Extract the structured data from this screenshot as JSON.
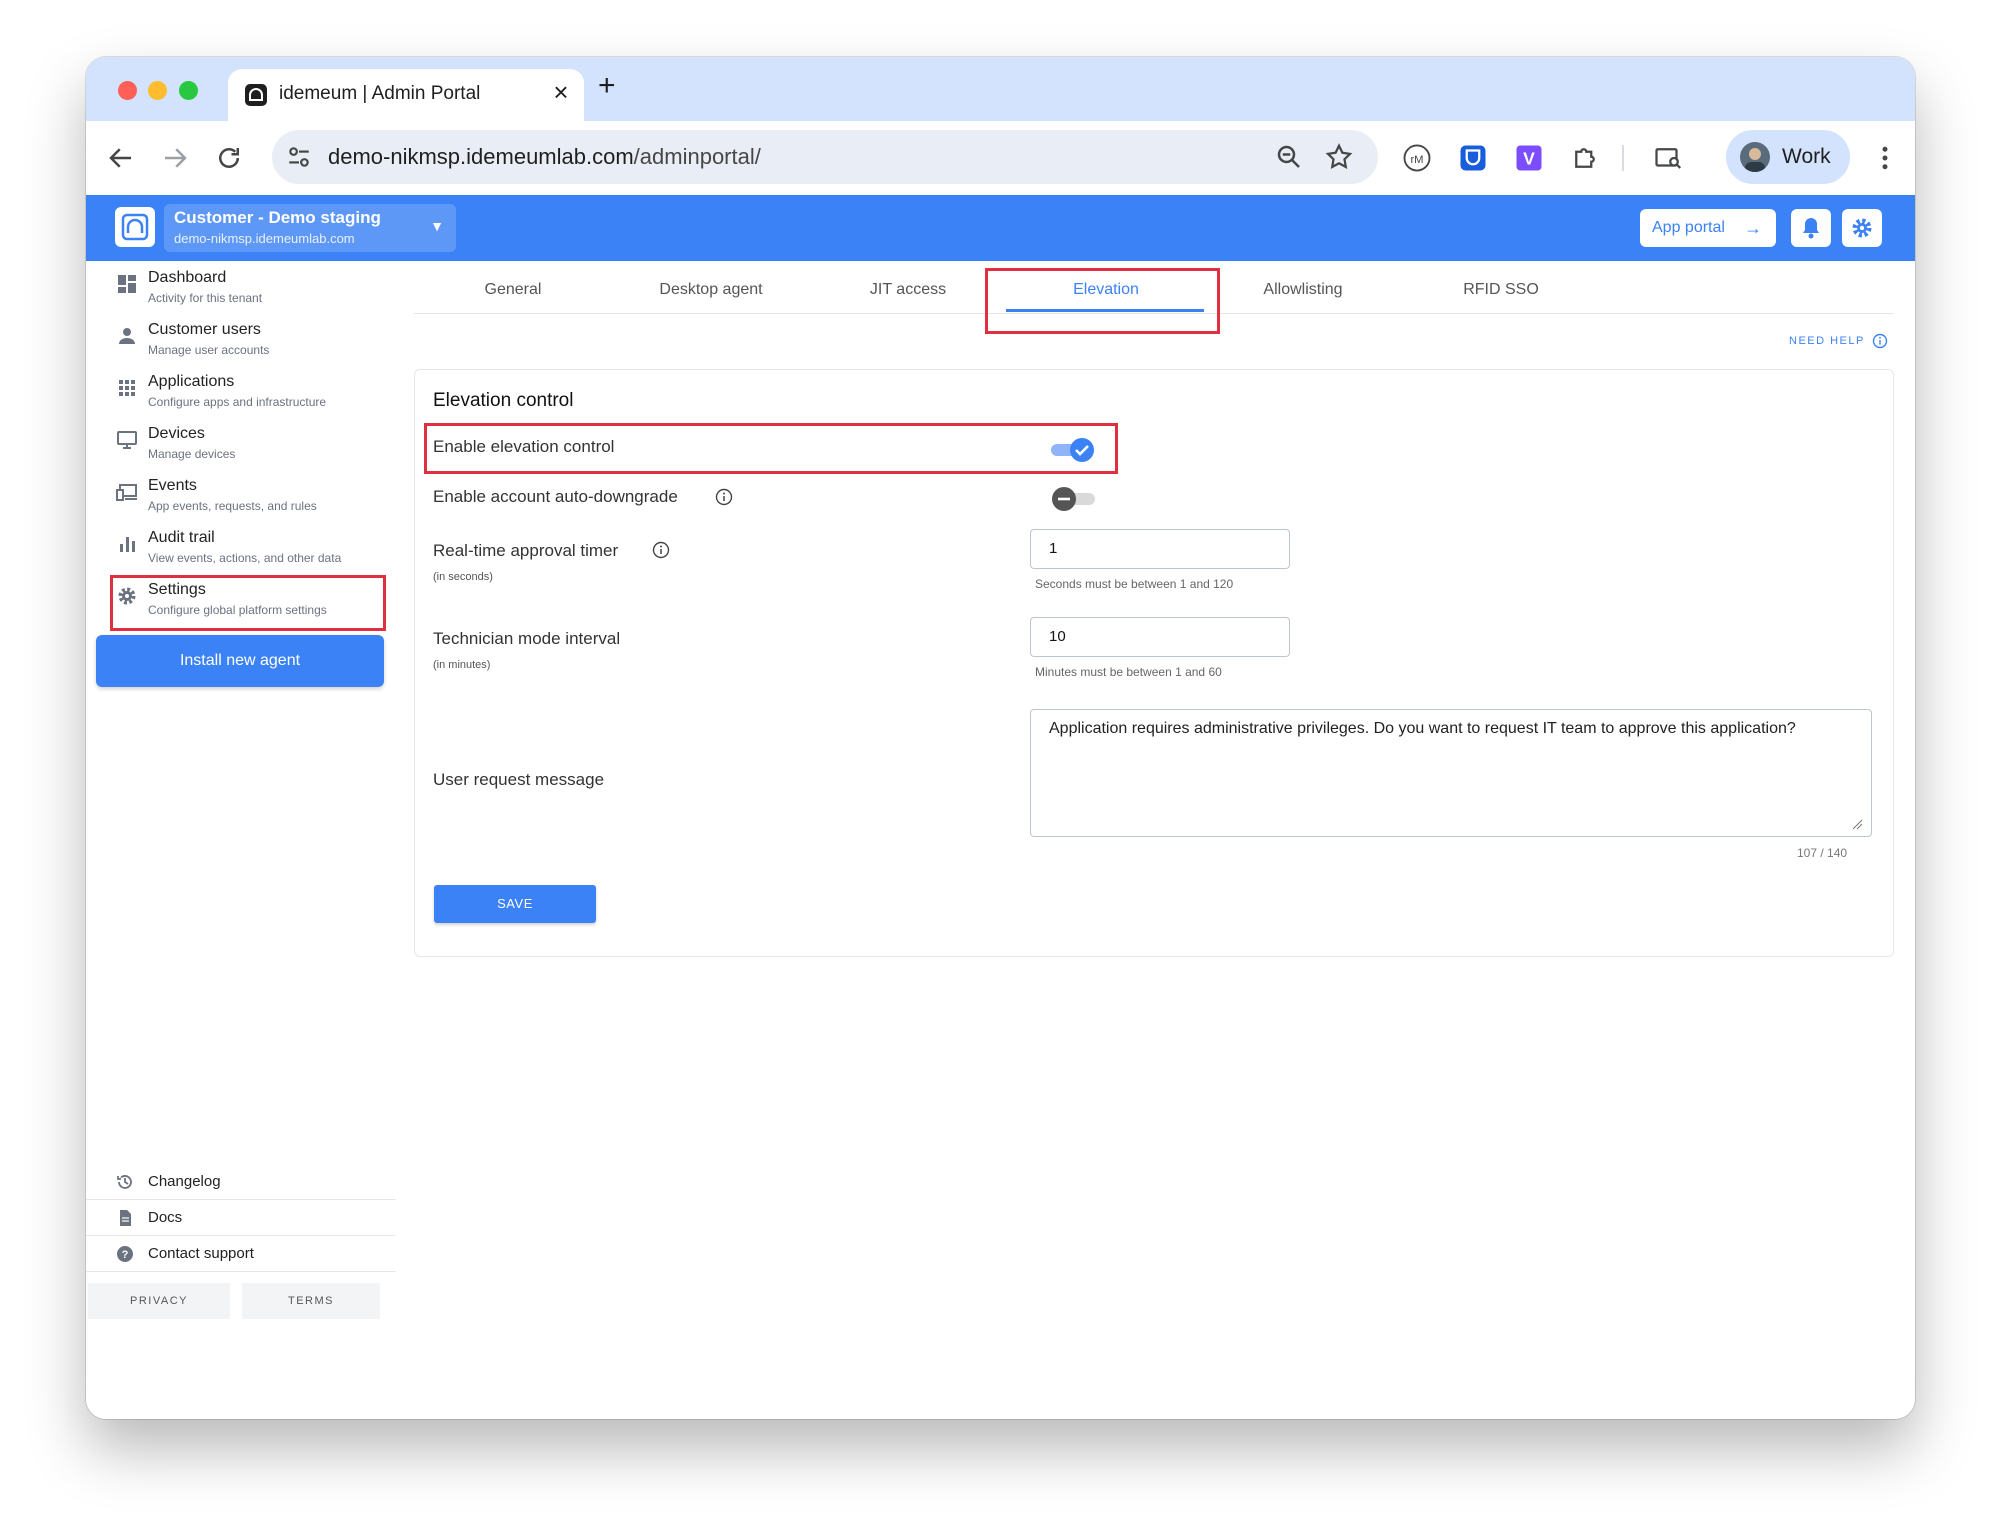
{
  "browser": {
    "tab_title": "idemeum | Admin Portal",
    "tab_close": "×",
    "new_tab": "+",
    "url_host": "demo-nikmsp.idemeumlab.com",
    "url_path": "/adminportal/",
    "profile_label": "Work"
  },
  "header": {
    "tenant_name": "Customer - Demo staging",
    "tenant_domain": "demo-nikmsp.idemeumlab.com",
    "app_portal_label": "App portal",
    "brand_color": "#3b82f6"
  },
  "sidebar": {
    "items": [
      {
        "title": "Dashboard",
        "subtitle": "Activity for this tenant",
        "icon": "dashboard-icon"
      },
      {
        "title": "Customer users",
        "subtitle": "Manage user accounts",
        "icon": "person-icon"
      },
      {
        "title": "Applications",
        "subtitle": "Configure apps and infrastructure",
        "icon": "apps-grid-icon"
      },
      {
        "title": "Devices",
        "subtitle": "Manage devices",
        "icon": "monitor-icon"
      },
      {
        "title": "Events",
        "subtitle": "App events, requests, and rules",
        "icon": "devices-icon"
      },
      {
        "title": "Audit trail",
        "subtitle": "View events, actions, and other data",
        "icon": "bar-chart-icon"
      },
      {
        "title": "Settings",
        "subtitle": "Configure global platform settings",
        "icon": "gear-icon"
      }
    ],
    "install_button": "Install new agent",
    "footer": [
      {
        "label": "Changelog",
        "icon": "history-icon"
      },
      {
        "label": "Docs",
        "icon": "document-icon"
      },
      {
        "label": "Contact support",
        "icon": "help-icon"
      }
    ],
    "privacy": "PRIVACY",
    "terms": "TERMS"
  },
  "tabs": [
    "General",
    "Desktop agent",
    "JIT access",
    "Elevation",
    "Allowlisting",
    "RFID SSO"
  ],
  "active_tab": "Elevation",
  "need_help": "NEED HELP",
  "card": {
    "title": "Elevation control",
    "enable_elevation_label": "Enable elevation control",
    "enable_elevation_on": true,
    "auto_downgrade_label": "Enable account auto-downgrade",
    "auto_downgrade_on": false,
    "timer_label": "Real-time approval timer",
    "timer_unit": "(in seconds)",
    "timer_value": "1",
    "timer_hint": "Seconds must be between 1 and 120",
    "tech_label": "Technician mode interval",
    "tech_unit": "(in minutes)",
    "tech_value": "10",
    "tech_hint": "Minutes must be between 1 and 60",
    "message_label": "User request message",
    "message_value": "Application requires administrative privileges. Do you want to request IT team to approve this application?",
    "message_counter": "107 / 140",
    "save_label": "SAVE"
  },
  "highlight_color": "#e0303f"
}
